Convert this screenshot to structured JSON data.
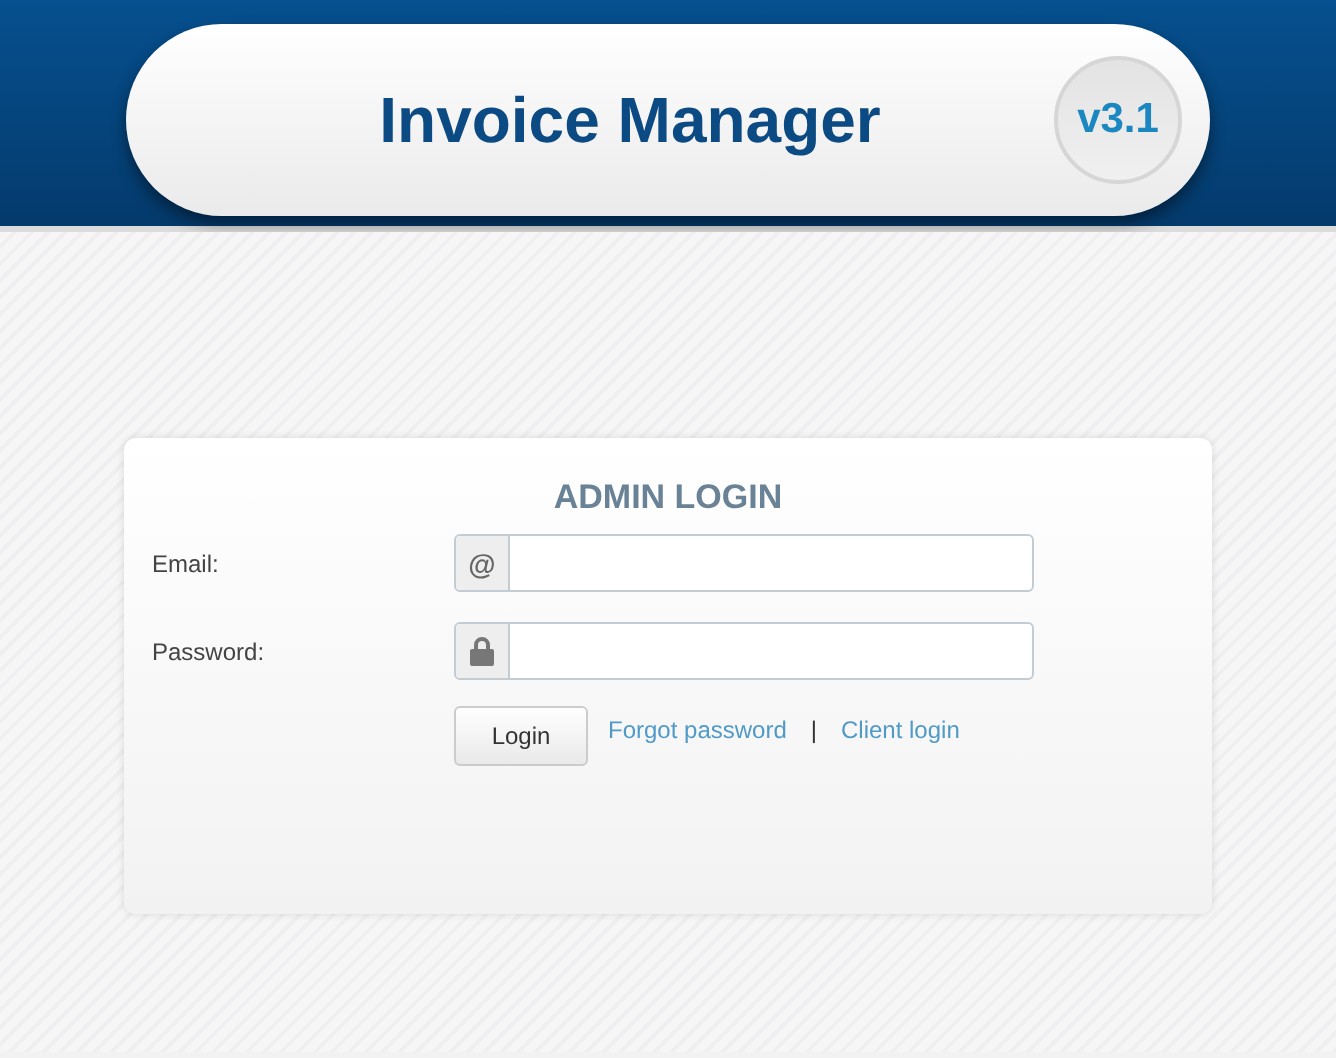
{
  "header": {
    "title": "Invoice Manager",
    "version": "v3.1"
  },
  "login": {
    "title": "ADMIN LOGIN",
    "fields": [
      {
        "label": "Email:",
        "kind": "email",
        "addon": "@"
      },
      {
        "label": "Password:",
        "kind": "password"
      }
    ],
    "button": "Login",
    "links": [
      "Forgot password",
      "Client login"
    ],
    "separator": "|"
  }
}
